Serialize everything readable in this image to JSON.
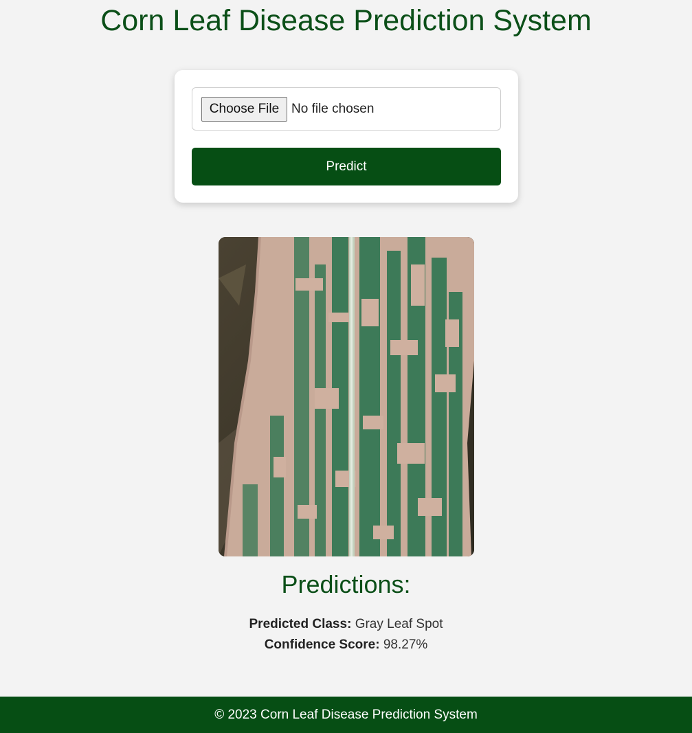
{
  "header": {
    "title": "Corn Leaf Disease Prediction System"
  },
  "upload_form": {
    "choose_file_label": "Choose File",
    "file_status": "No file chosen",
    "predict_label": "Predict"
  },
  "image": {
    "subject": "corn leaf with gray leaf spot lesions"
  },
  "predictions": {
    "heading": "Predictions:",
    "class_label": "Predicted Class:",
    "class_value": "Gray Leaf Spot",
    "confidence_label": "Confidence Score:",
    "confidence_value": "98.27%"
  },
  "footer": {
    "text": "© 2023 Corn Leaf Disease Prediction System"
  },
  "colors": {
    "brand_green": "#064e14",
    "title_green": "#0b4f18",
    "page_background": "#f3f3f3"
  }
}
